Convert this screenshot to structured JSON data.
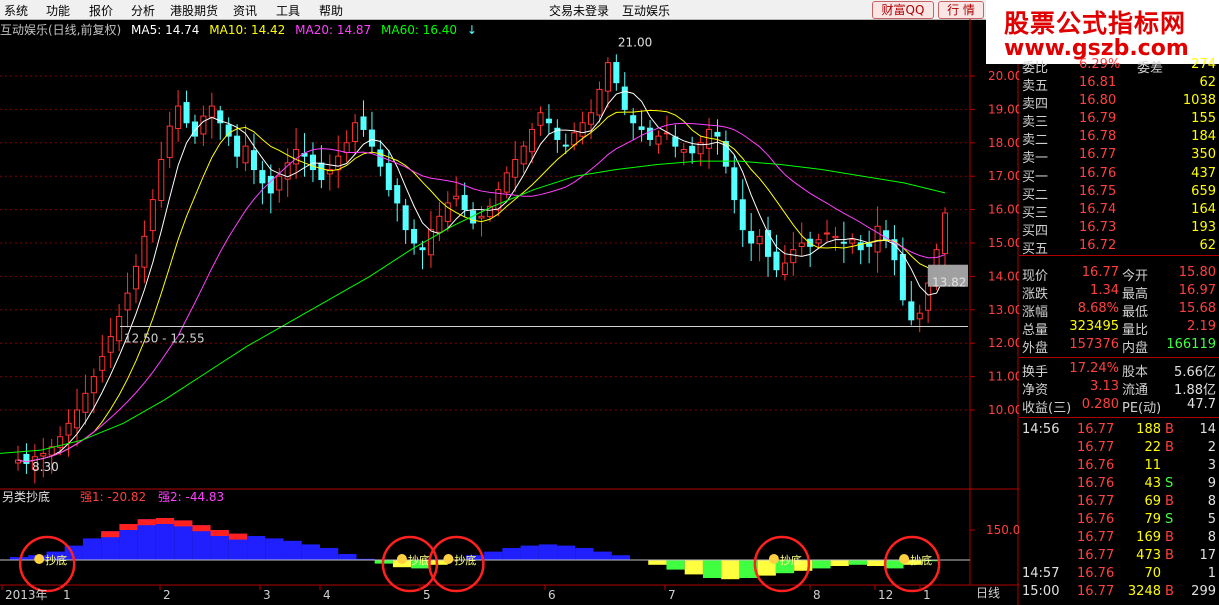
{
  "menubar": {
    "items": [
      "系统",
      "功能",
      "报价",
      "分析",
      "港股期货",
      "资讯",
      "工具",
      "帮助"
    ],
    "status": "交易未登录",
    "stock_name": "互动娱乐",
    "btn_caifu": "财富QQ",
    "btn_hangqing": "行 情"
  },
  "watermark": {
    "line1": "股票公式指标网",
    "line2": "www.gszb.com"
  },
  "infobar": {
    "title": "互动娱乐(日线,前复权)",
    "ma5": "MA5: 14.74",
    "ma10": "MA10: 14.42",
    "ma20": "MA20: 14.87",
    "ma60": "MA60: 16.40"
  },
  "chart_data": {
    "type": "candlestick",
    "price_axis_ticks": [
      "20.00",
      "19.00",
      "18.00",
      "17.00",
      "16.00",
      "15.00",
      "14.00",
      "13.00",
      "12.00",
      "11.00",
      "10.00"
    ],
    "annotations": {
      "high": "21.00",
      "low": "8.30",
      "range": "12.50 - 12.55",
      "cursor_price": "13.82"
    },
    "x_tick_labels": [
      "2013年",
      "1",
      "2",
      "3",
      "4",
      "5",
      "6",
      "7",
      "8",
      "12",
      "1"
    ],
    "indicator_title": "另类抄底",
    "indicator_s1": "强1: -20.82",
    "indicator_s2": "强2: -44.83",
    "indicator_axis": "150.0",
    "signal_label": "抄底",
    "closes": [
      8.5,
      8.4,
      8.6,
      8.7,
      8.9,
      9.2,
      9.6,
      10.0,
      10.5,
      11.0,
      11.6,
      12.2,
      12.8,
      13.5,
      14.3,
      15.2,
      16.3,
      17.5,
      18.5,
      19.1,
      18.6,
      18.2,
      18.8,
      19.1,
      18.6,
      18.2,
      17.6,
      17.9,
      17.2,
      16.8,
      16.5,
      17.0,
      17.4,
      17.8,
      17.6,
      17.2,
      16.9,
      17.2,
      17.6,
      18.0,
      18.6,
      18.4,
      17.9,
      17.3,
      16.6,
      16.2,
      15.4,
      15.0,
      14.8,
      15.4,
      15.8,
      16.2,
      16.4,
      16.0,
      15.6,
      15.8,
      16.1,
      16.6,
      17.1,
      17.5,
      17.9,
      18.4,
      18.9,
      18.6,
      18.1,
      17.9,
      18.3,
      18.6,
      18.9,
      19.6,
      20.4,
      19.8,
      19.0,
      18.6,
      18.4,
      18.1,
      18.2,
      18.3,
      17.9,
      17.8,
      17.7,
      18.0,
      18.4,
      18.2,
      17.3,
      16.3,
      15.4,
      15.0,
      15.2,
      14.6,
      14.2,
      14.4,
      14.8,
      15.0,
      14.9,
      15.1,
      15.3,
      15.2,
      15.0,
      15.1,
      14.8,
      14.9,
      15.5,
      15.1,
      14.5,
      13.3,
      12.7,
      12.9,
      13.8,
      14.8,
      15.9
    ],
    "ma60_sample": [
      8.7,
      8.8,
      9.1,
      9.6,
      10.3,
      11.1,
      11.9,
      12.6,
      13.3,
      14.0,
      14.8,
      15.5,
      16.1,
      16.6,
      17.0,
      17.2,
      17.35,
      17.45,
      17.45,
      17.35,
      17.2,
      17.0,
      16.8,
      16.5
    ],
    "indicator_values": [
      5,
      8,
      14,
      24,
      36,
      48,
      60,
      68,
      70,
      66,
      58,
      50,
      44,
      40,
      36,
      32,
      26,
      20,
      10,
      2,
      -6,
      -12,
      -14,
      -8,
      0,
      8,
      14,
      20,
      24,
      26,
      24,
      20,
      14,
      8,
      0,
      -8,
      -16,
      -24,
      -30,
      -32,
      -30,
      -26,
      -22,
      -18,
      -14,
      -10,
      -8,
      -10,
      -14,
      -8,
      -2
    ],
    "signal_markers": [
      0.04,
      0.43,
      0.48,
      0.83,
      0.97
    ]
  },
  "orderbook": {
    "top_label": "委比",
    "top_value": "6.29%",
    "top_label2": "委差",
    "top_vol": "274",
    "asks": [
      {
        "label": "卖五",
        "price": "16.81",
        "vol": "62"
      },
      {
        "label": "卖四",
        "price": "16.80",
        "vol": "1038"
      },
      {
        "label": "卖三",
        "price": "16.79",
        "vol": "155"
      },
      {
        "label": "卖二",
        "price": "16.78",
        "vol": "184"
      },
      {
        "label": "卖一",
        "price": "16.77",
        "vol": "350"
      }
    ],
    "bids": [
      {
        "label": "买一",
        "price": "16.76",
        "vol": "437"
      },
      {
        "label": "买二",
        "price": "16.75",
        "vol": "659"
      },
      {
        "label": "买三",
        "price": "16.74",
        "vol": "164"
      },
      {
        "label": "买四",
        "price": "16.73",
        "vol": "193"
      },
      {
        "label": "买五",
        "price": "16.72",
        "vol": "62"
      }
    ]
  },
  "stats": [
    {
      "l1": "现价",
      "v1": "16.77",
      "l2": "今开",
      "v2": "15.80"
    },
    {
      "l1": "涨跌",
      "v1": "1.34",
      "l2": "最高",
      "v2": "16.97"
    },
    {
      "l1": "涨幅",
      "v1": "8.68%",
      "l2": "最低",
      "v2": "15.68"
    },
    {
      "l1": "总量",
      "v1": "323495",
      "l2": "量比",
      "v2": "2.19"
    },
    {
      "l1": "外盘",
      "v1": "157376",
      "l2": "内盘",
      "v2": "166119"
    },
    {
      "l1": "换手",
      "v1": "17.24%",
      "l2": "股本",
      "v2": "5.66亿"
    },
    {
      "l1": "净资",
      "v1": "3.13",
      "l2": "流通",
      "v2": "1.88亿"
    },
    {
      "l1": "收益(三)",
      "v1": "0.280",
      "l2": "PE(动)",
      "v2": "47.7"
    }
  ],
  "ticks": [
    {
      "time": "14:56",
      "price": "16.77",
      "vol": "188",
      "side": "B",
      "n": "14"
    },
    {
      "time": "",
      "price": "16.77",
      "vol": "22",
      "side": "B",
      "n": "2"
    },
    {
      "time": "",
      "price": "16.76",
      "vol": "11",
      "side": "",
      "n": "3"
    },
    {
      "time": "",
      "price": "16.76",
      "vol": "43",
      "side": "S",
      "n": "9"
    },
    {
      "time": "",
      "price": "16.77",
      "vol": "69",
      "side": "B",
      "n": "8"
    },
    {
      "time": "",
      "price": "16.76",
      "vol": "79",
      "side": "S",
      "n": "5"
    },
    {
      "time": "",
      "price": "16.77",
      "vol": "169",
      "side": "B",
      "n": "8"
    },
    {
      "time": "",
      "price": "16.77",
      "vol": "473",
      "side": "B",
      "n": "17"
    },
    {
      "time": "14:57",
      "price": "16.76",
      "vol": "70",
      "side": "",
      "n": "1"
    },
    {
      "time": "15:00",
      "price": "16.77",
      "vol": "3248",
      "side": "B",
      "n": "299"
    }
  ],
  "bottom_tab": "日线",
  "colors": {
    "up": "#ff3232",
    "down": "#54ffff",
    "ma5": "#ffffff",
    "ma10": "#ffff00",
    "ma20": "#ff40ff",
    "ma60": "#00ff00",
    "grid": "#800000",
    "indicator_up": "#ff2020",
    "indicator_down": "#2020ff",
    "indicator_neg": "#ffff40",
    "indicator_neg2": "#40ff40"
  }
}
